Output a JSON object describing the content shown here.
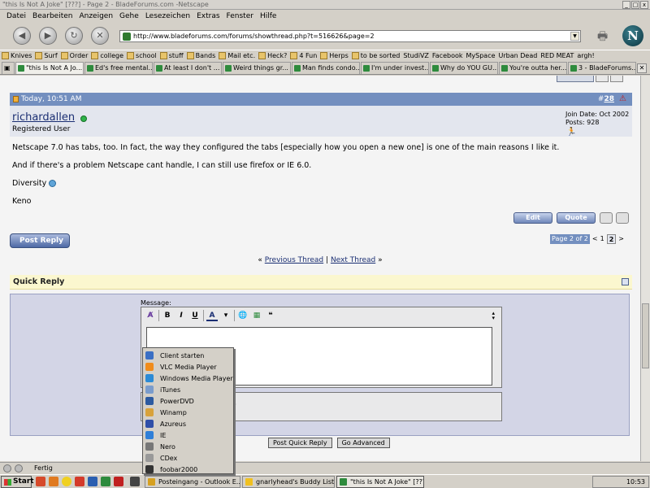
{
  "window": {
    "title": "\"this Is Not A Joke\" [???] - Page 2 - BladeForums.com -Netscape",
    "min_label": "_",
    "max_label": "□",
    "close_label": "x"
  },
  "menu": [
    "Datei",
    "Bearbeiten",
    "Anzeigen",
    "Gehe",
    "Lesezeichen",
    "Extras",
    "Fenster",
    "Hilfe"
  ],
  "nav": {
    "url": "http://www.bladeforums.com/forums/showthread.php?t=516626&page=2",
    "logo_letter": "N"
  },
  "bookmarks": [
    "Knives",
    "Surf",
    "Order",
    "college",
    "school",
    "stuff",
    "Bands",
    "Mail etc.",
    "Heck?",
    "4 Fun",
    "Herps",
    "to be sorted",
    "StudiVZ",
    "Facebook",
    "MySpace",
    "Urban Dead",
    "RED MEAT",
    "argh!"
  ],
  "tabs": [
    "\"this Is Not A Jo...",
    "Ed's free mental...",
    "At least I don't ...",
    "Weird things gr...",
    "Man finds condo...",
    "I'm under invest...",
    "Why do YOU GU...",
    "You're outta her...",
    "3 - BladeForums..."
  ],
  "post": {
    "date": "Today, 10:51 AM",
    "number_prefix": "#",
    "number": "28",
    "username": "richardallen",
    "user_title": "Registered User",
    "join_date": "Join Date: Oct 2002",
    "posts": "Posts: 928",
    "lines": [
      "Netscape 7.0 has tabs, too. In fact, the way they configured the tabs [especially how you open a new one] is one of the main reasons I like it.",
      "And if there's a problem Netscape cant handle, I can still use firefox or IE 6.0.",
      "Diversity",
      "Keno"
    ],
    "edit_label": "Edit",
    "quote_label": "Quote"
  },
  "post_reply_label": "Post Reply",
  "pagenav": {
    "label": "Page 2 of 2",
    "prev": "<",
    "page1": "1",
    "page2": "2",
    "next": ">"
  },
  "threadnav": {
    "left_arrows": "«",
    "prev": "Previous Thread",
    "sep": "|",
    "next": "Next Thread",
    "right_arrows": "»"
  },
  "quick_reply": {
    "title": "Quick Reply",
    "message_label": "Message:",
    "toolbar": [
      "B",
      "I",
      "U",
      "A"
    ],
    "option_text": "?",
    "submit_label": "Post Quick Reply",
    "advanced_label": "Go Advanced"
  },
  "popup_items": [
    {
      "label": "Client starten",
      "color": "#3a6fc4"
    },
    {
      "label": "VLC Media Player",
      "color": "#f08c1a"
    },
    {
      "label": "Windows Media Player",
      "color": "#2b8bd6"
    },
    {
      "label": "iTunes",
      "color": "#7a9ccc"
    },
    {
      "label": "PowerDVD",
      "color": "#2c5aa0"
    },
    {
      "label": "Winamp",
      "color": "#d8a23a"
    },
    {
      "label": "Azureus",
      "color": "#2f4fa8"
    },
    {
      "label": "IE",
      "color": "#2f7fd8"
    },
    {
      "label": "Nero",
      "color": "#777777"
    },
    {
      "label": "CDex",
      "color": "#999999"
    },
    {
      "label": "foobar2000",
      "color": "#333333"
    }
  ],
  "status": {
    "text": "Fertig"
  },
  "taskbar": {
    "start": "Start",
    "items": [
      "Posteingang - Outlook E...",
      "gnarlyhead's Buddy List ...",
      "\"this Is Not A Joke\" [???]..."
    ],
    "clock": "10:53"
  }
}
